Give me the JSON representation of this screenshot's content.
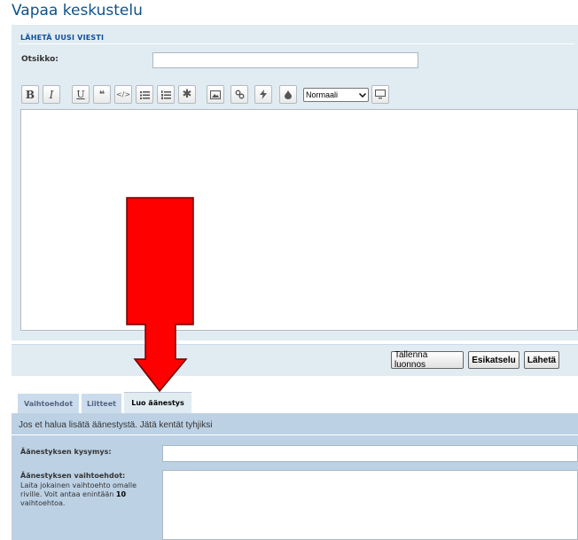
{
  "page": {
    "title": "Vapaa keskustelu"
  },
  "post_form": {
    "heading": "LÄHETÄ UUSI VIESTI",
    "subject_label": "Otsikko:",
    "subject_value": ""
  },
  "toolbar": {
    "bold": "B",
    "italic": "I",
    "underline": "U",
    "quote": "❝",
    "code": "</>",
    "size_select": "Normaali"
  },
  "submit_buttons": {
    "save_draft": "Tallenna luonnos",
    "preview": "Esikatselu",
    "submit": "Lähetä"
  },
  "tabs": [
    {
      "label": "Vaihtoehdot"
    },
    {
      "label": "Liitteet"
    },
    {
      "label": "Luo äänestys"
    }
  ],
  "poll": {
    "note": "Jos et halua lisätä äänestystä. Jätä kentät tyhjiksi",
    "question_label": "Äänestyksen kysymys:",
    "options_label": "Äänestyksen vaihtoehdot:",
    "options_help_pre": "Laita jokainen vaihtoehto omalle riville. Voit antaa enintään ",
    "options_help_max": "10",
    "options_help_post": " vaihtoehtoa."
  },
  "colors": {
    "title": "#105289",
    "panel_bg": "#e1ebf2",
    "poll_bg": "#bdd1e4",
    "annotation_arrow": "#ff0000"
  }
}
